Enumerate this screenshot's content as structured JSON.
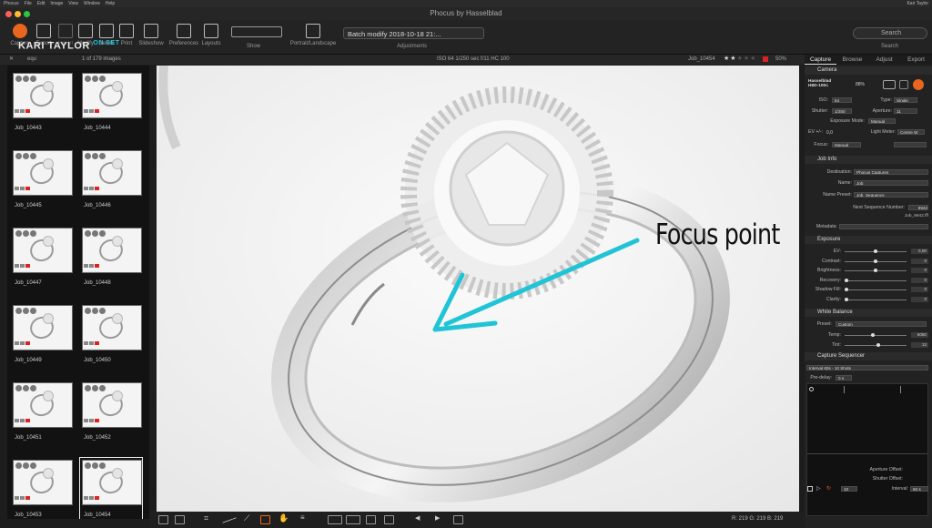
{
  "window": {
    "title": "Phocus by Hasselblad"
  },
  "menubar": {
    "items": [
      "Phocus",
      "File",
      "Edit",
      "Image",
      "View",
      "Window",
      "Help"
    ],
    "right": [
      "Kari Taylor"
    ]
  },
  "brand": {
    "name": "KARI TAYLOR",
    "sub": "ON SET"
  },
  "toolbar": {
    "capture": "Capture",
    "export": "Export",
    "import": "Import",
    "modify": "Modify",
    "delete": "Delete",
    "print": "Print",
    "slideshow": "Slideshow",
    "preferences": "Preferences",
    "layouts": "Layouts",
    "show": "Show",
    "portrait_landscape": "Portrait/Landscape",
    "batch_value": "Batch modify 2018-10-18 21:...",
    "adjustments": "Adjustments",
    "search_placeholder": "Search",
    "search_label": "Search"
  },
  "bar2": {
    "filter": "equ",
    "count": "1 of 179 images",
    "exif": "ISO 64   1/250 sec   f/11   HC 100",
    "image_name": "Job_10454",
    "zoom": "50%",
    "rating_stars": 2
  },
  "browser": {
    "thumbnails": [
      {
        "name": "Job_10443"
      },
      {
        "name": "Job_10444"
      },
      {
        "name": "Job_10445"
      },
      {
        "name": "Job_10446"
      },
      {
        "name": "Job_10447"
      },
      {
        "name": "Job_10448"
      },
      {
        "name": "Job_10449"
      },
      {
        "name": "Job_10450"
      },
      {
        "name": "Job_10451"
      },
      {
        "name": "Job_10452"
      },
      {
        "name": "Job_10453"
      },
      {
        "name": "Job_10454"
      }
    ],
    "selected": "Job_10454"
  },
  "viewer": {
    "annotation": "Focus point",
    "annotation_color": "#1fc4d6"
  },
  "viewer_bar": {
    "readout": "R: 219  G: 219  B: 219"
  },
  "panel": {
    "tabs": [
      "Capture",
      "Browse",
      "Adjust",
      "Export"
    ],
    "active_tab": "Capture",
    "camera": {
      "section": "Camera",
      "model": "Hasselblad H6D-100c",
      "battery": "88%",
      "iso_label": "ISO:",
      "iso": "64",
      "type_label": "Type:",
      "type": "Single",
      "shutter_label": "Shutter:",
      "shutter": "1/250",
      "aperture_label": "Aperture:",
      "aperture": "11",
      "mode_label": "Exposure Mode:",
      "mode": "Manual",
      "ev_label": "EV +/-:",
      "ev": "0,0",
      "meter_label": "Light Meter:",
      "meter": "Centre W",
      "focus_label": "Focus:",
      "focus": "Manual"
    },
    "job": {
      "section": "Job Info",
      "dest_label": "Destination:",
      "dest": "Phocus Captures",
      "name_label": "Name:",
      "name": "Job",
      "preset_label": "Name Preset:",
      "preset": "Job_Sequence",
      "next_label": "Next Sequence Number:",
      "next": "9942",
      "next_file": "Job_9942.fff",
      "meta_label": "Metadata:"
    },
    "exposure": {
      "section": "Exposure",
      "sliders": [
        {
          "label": "EV:",
          "value": "0,00",
          "pos": 0.5
        },
        {
          "label": "Contrast:",
          "value": "0",
          "pos": 0.5
        },
        {
          "label": "Brightness:",
          "value": "0",
          "pos": 0.5
        },
        {
          "label": "Recovery:",
          "value": "0",
          "pos": 0.0
        },
        {
          "label": "Shadow Fill:",
          "value": "0",
          "pos": 0.0
        },
        {
          "label": "Clarity:",
          "value": "0",
          "pos": 0.0
        }
      ]
    },
    "white_balance": {
      "section": "White Balance",
      "preset_label": "Preset:",
      "preset": "Custom",
      "sliders": [
        {
          "label": "Temp:",
          "value": "5050",
          "pos": 0.46
        },
        {
          "label": "Tint:",
          "value": "13",
          "pos": 0.55
        }
      ]
    },
    "sequencer": {
      "section": "Capture Sequencer",
      "preset": "Interval 60s - 10 Shots",
      "predelay_label": "Pre-delay:",
      "predelay": "0  s",
      "aperture_offset_label": "Aperture Offset:",
      "shutter_offset_label": "Shutter Offset:",
      "shots": "10",
      "interval_label": "Interval:",
      "interval": "60  s"
    }
  },
  "colors": {
    "record": "#e8661d",
    "accent": "#1fc4d6"
  }
}
